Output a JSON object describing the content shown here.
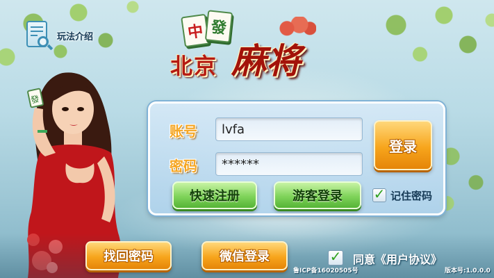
{
  "help": {
    "label": "玩法介绍",
    "icon": "rules-book-search-icon"
  },
  "logo": {
    "tiles": [
      "中",
      "發"
    ],
    "line1": "北京",
    "line2": "麻将"
  },
  "login": {
    "account_label": "账号",
    "account_value": "lvfa",
    "password_label": "密码",
    "password_value": "******",
    "login_button": "登录",
    "register_button": "快速注册",
    "guest_button": "游客登录",
    "remember_label": "记住密码",
    "remember_checked": true
  },
  "bottom": {
    "recover_button": "找回密码",
    "wechat_button": "微信登录",
    "agree_label": "同意《用户协议》",
    "agree_checked": true,
    "icp": "鲁ICP备16020505号",
    "version": "版本号:1.0.0.0"
  },
  "colors": {
    "orange_button": "#f7a51c",
    "green_button": "#7fd35a",
    "logo_red": "#b51a12",
    "panel_blue": "#b0d3ec"
  }
}
